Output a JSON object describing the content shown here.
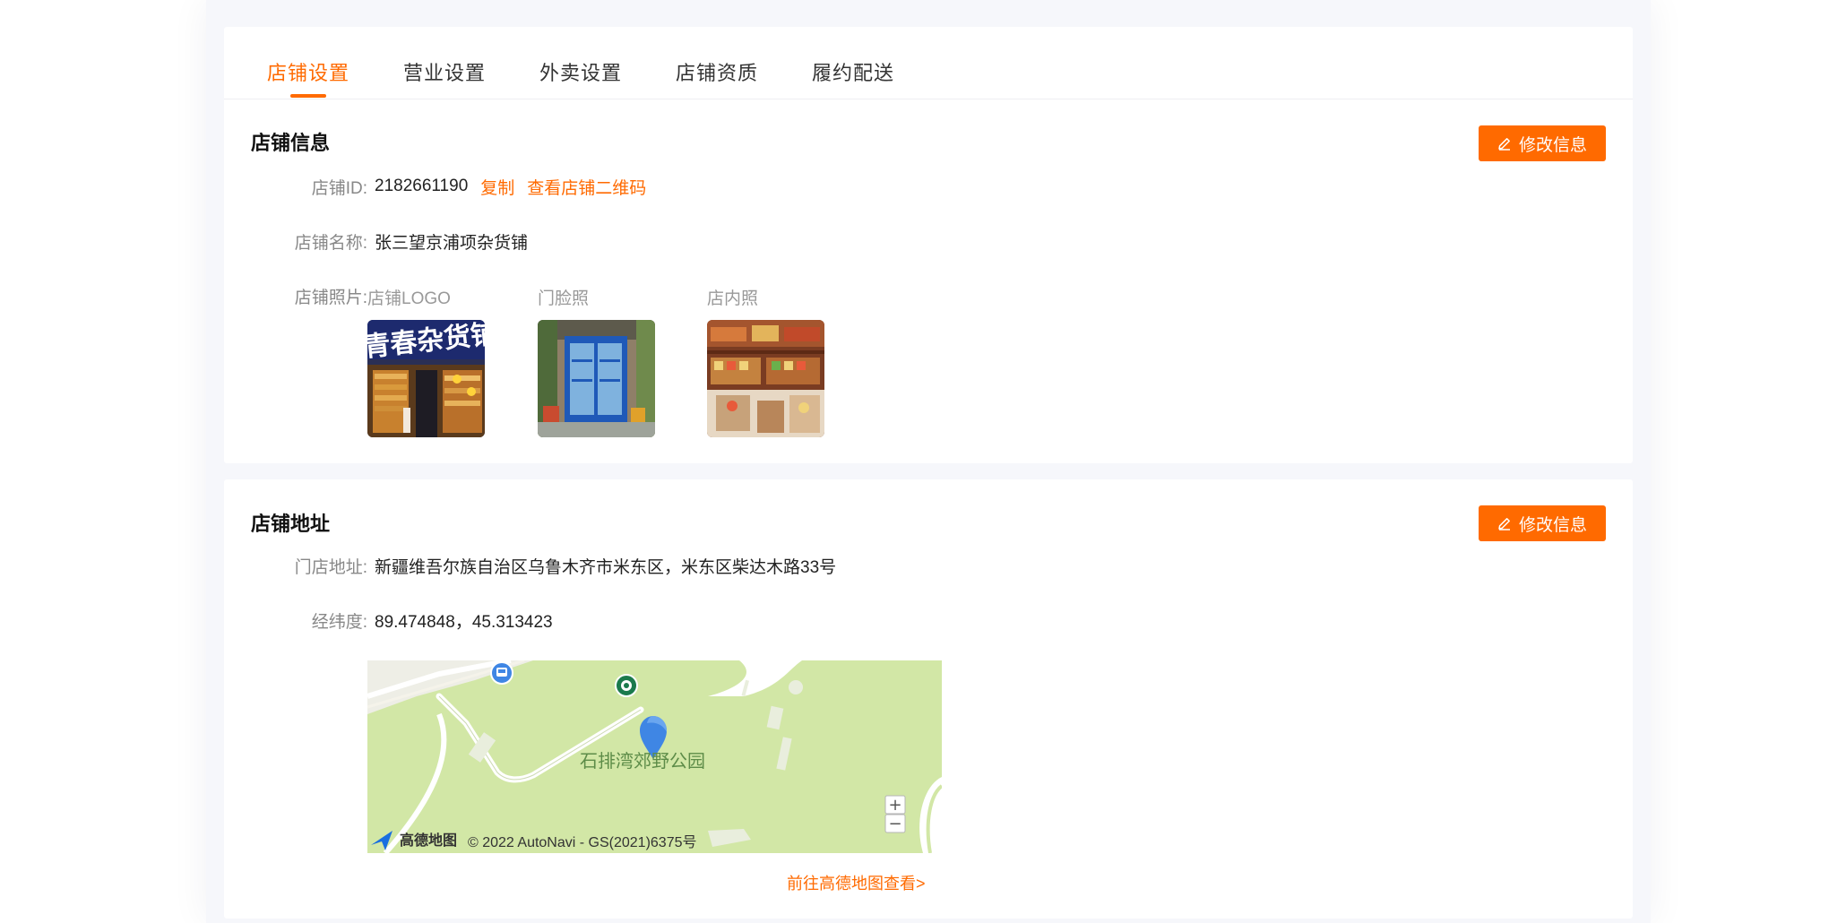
{
  "tabs": [
    {
      "label": "店铺设置"
    },
    {
      "label": "营业设置"
    },
    {
      "label": "外卖设置"
    },
    {
      "label": "店铺资质"
    },
    {
      "label": "履约配送"
    }
  ],
  "colors": {
    "accent": "#ff6a00",
    "page_bg": "#f6f7fb"
  },
  "store_info": {
    "title": "店铺信息",
    "edit_label": "修改信息",
    "id_label": "店铺ID:",
    "id_value": "2182661190",
    "copy_label": "复制",
    "qr_label": "查看店铺二维码",
    "name_label": "店铺名称:",
    "name_value": "张三望京浦项杂货铺",
    "photos_label": "店铺照片:",
    "photos": [
      {
        "caption": "店铺LOGO",
        "sign_text": "青春杂货铺"
      },
      {
        "caption": "门脸照"
      },
      {
        "caption": "店内照"
      }
    ]
  },
  "store_address": {
    "title": "店铺地址",
    "edit_label": "修改信息",
    "address_label": "门店地址:",
    "address_value": "新疆维吾尔族自治区乌鲁木齐市米东区，米东区柴达木路33号",
    "coord_label": "经纬度:",
    "coord_value": "89.474848，45.313423",
    "map": {
      "place_name": "石排湾郊野公园",
      "brand": "高德地图",
      "copyright": "© 2022 AutoNavi - GS(2021)6375号",
      "zoom_in": "+",
      "zoom_out": "−"
    },
    "map_link": "前往高德地图查看>"
  }
}
